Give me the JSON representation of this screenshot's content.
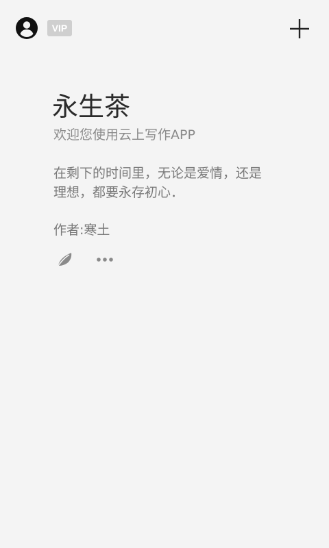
{
  "header": {
    "vip_label": "VIP",
    "profile_icon": "account-circle-icon",
    "add_icon": "plus-icon"
  },
  "card": {
    "title": "永生茶",
    "subtitle": "欢迎您使用云上写作APP",
    "body_line1": "在剩下的时间里，无论是爱情，还是",
    "body_line2": "理想，都要永存初心．",
    "author": "作者:寒土",
    "actions": {
      "leaf_icon": "leaf-icon",
      "more_icon": "more-horizontal-icon"
    }
  },
  "colors": {
    "background": "#f4f4f4",
    "title": "#2b2b2b",
    "secondary_text": "#7a7a7a",
    "vip_badge": "#cfcfcf",
    "icon_dark": "#1a1a1a",
    "icon_gray": "#8a8a8a"
  }
}
